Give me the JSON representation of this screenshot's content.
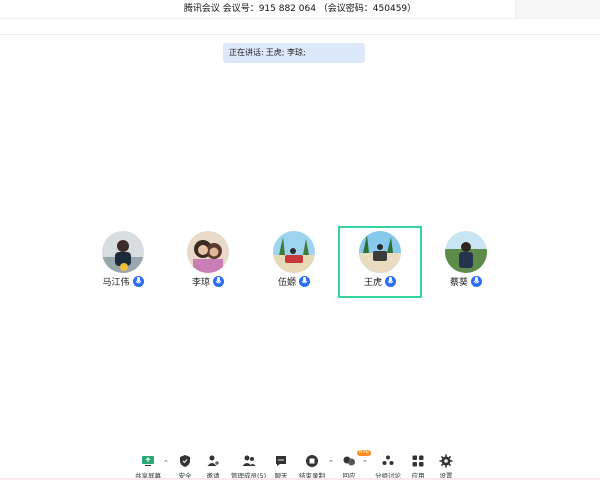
{
  "window": {
    "title": "腾讯会议 会议号：915 882 064 （会议密码：450459）"
  },
  "speaking": {
    "label": "正在讲话:",
    "names": "王虎; 李琼;"
  },
  "participants": [
    {
      "name": "马江伟",
      "mic": "mic-icon"
    },
    {
      "name": "李琼",
      "mic": "mic-icon"
    },
    {
      "name": "伍嫄",
      "mic": "mic-icon"
    },
    {
      "name": "王虎",
      "mic": "mic-icon",
      "active": true
    },
    {
      "name": "蔡葵",
      "mic": "mic-icon"
    }
  ],
  "toolbar": {
    "share": "共享屏幕",
    "security": "安全",
    "invite": "邀请",
    "members": "管理成员(5)",
    "chat": "聊天",
    "record": "结束录制",
    "reactions": "回应",
    "reactions_badge": "New",
    "breakout": "分组讨论",
    "apps": "应用",
    "settings": "设置"
  },
  "colors": {
    "accent": "#2b6ef5",
    "active_border": "#35d3a1",
    "speaking_bg": "#dde8fb",
    "badge": "#ff8a1f"
  }
}
